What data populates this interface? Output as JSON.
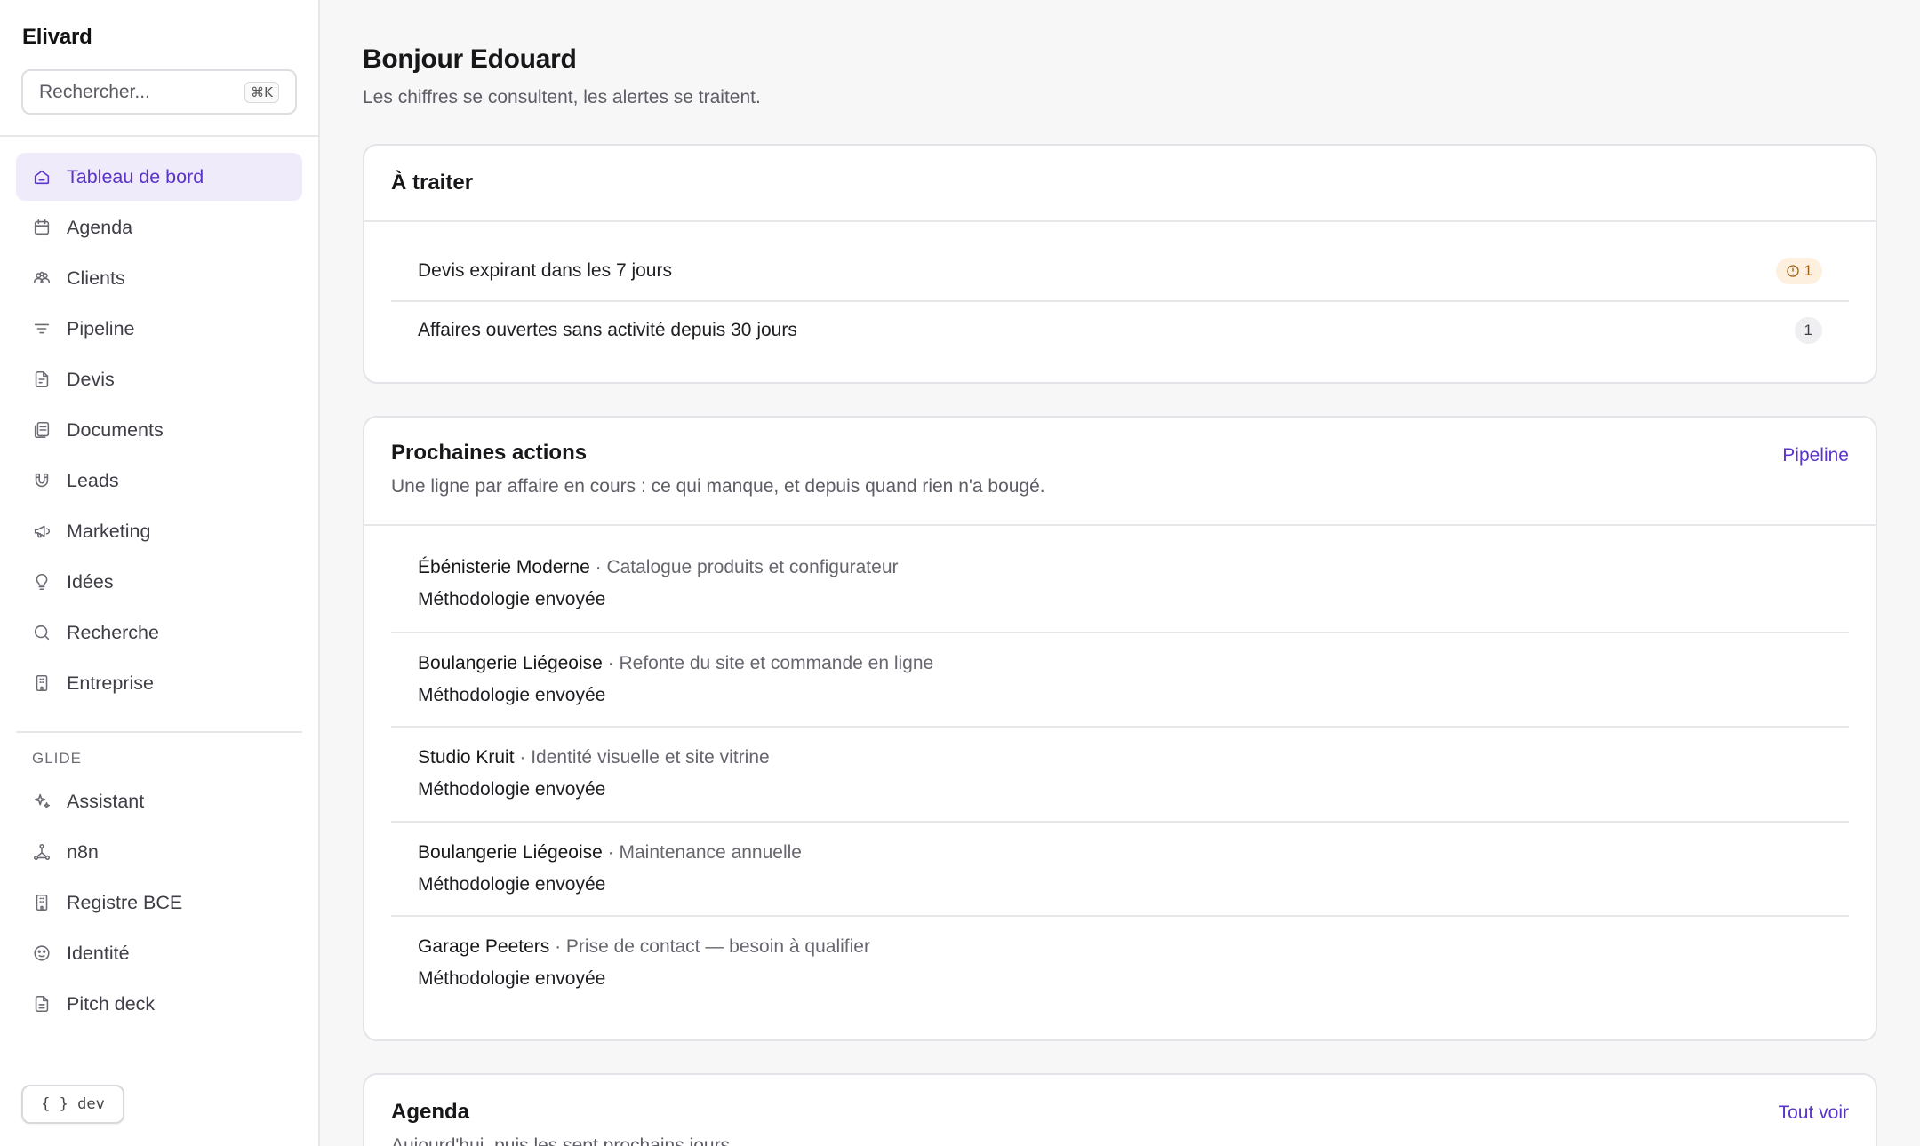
{
  "sidebar": {
    "brand": "Elivard",
    "search": {
      "placeholder": "Rechercher...",
      "shortcut": "⌘K"
    },
    "items": [
      {
        "label": "Tableau de bord",
        "icon": "home-icon",
        "active": true
      },
      {
        "label": "Agenda",
        "icon": "calendar-icon"
      },
      {
        "label": "Clients",
        "icon": "users-icon"
      },
      {
        "label": "Pipeline",
        "icon": "filter-icon"
      },
      {
        "label": "Devis",
        "icon": "file-invoice-icon"
      },
      {
        "label": "Documents",
        "icon": "documents-icon"
      },
      {
        "label": "Leads",
        "icon": "magnet-icon"
      },
      {
        "label": "Marketing",
        "icon": "megaphone-icon"
      },
      {
        "label": "Idées",
        "icon": "lightbulb-icon"
      },
      {
        "label": "Recherche",
        "icon": "search-icon"
      },
      {
        "label": "Entreprise",
        "icon": "building-icon"
      }
    ],
    "section_label": "GLIDE",
    "glide_items": [
      {
        "label": "Assistant",
        "icon": "sparkles-icon"
      },
      {
        "label": "n8n",
        "icon": "workflow-icon"
      },
      {
        "label": "Registre BCE",
        "icon": "building-icon"
      },
      {
        "label": "Identité",
        "icon": "palette-icon"
      },
      {
        "label": "Pitch deck",
        "icon": "presentation-icon"
      }
    ],
    "dev_button": "{ } dev"
  },
  "main": {
    "greeting": "Bonjour Edouard",
    "subtitle": "Les chiffres se consultent, les alertes se traitent.",
    "todo": {
      "title": "À traiter",
      "rows": [
        {
          "label": "Devis expirant dans les 7 jours",
          "count": "1",
          "level": "warning"
        },
        {
          "label": "Affaires ouvertes sans activité depuis 30 jours",
          "count": "1",
          "level": "neutral"
        }
      ]
    },
    "next_actions": {
      "title": "Prochaines actions",
      "description": "Une ligne par affaire en cours : ce qui manque, et depuis quand rien n'a bougé.",
      "link": "Pipeline",
      "rows": [
        {
          "client": "Ébénisterie Moderne",
          "project": " · Catalogue produits et configurateur",
          "status": "Méthodologie envoyée"
        },
        {
          "client": "Boulangerie Liégeoise",
          "project": " · Refonte du site et commande en ligne",
          "status": "Méthodologie envoyée"
        },
        {
          "client": "Studio Kruit",
          "project": " · Identité visuelle et site vitrine",
          "status": "Méthodologie envoyée"
        },
        {
          "client": "Boulangerie Liégeoise",
          "project": " · Maintenance annuelle",
          "status": "Méthodologie envoyée"
        },
        {
          "client": "Garage Peeters",
          "project": " · Prise de contact — besoin à qualifier",
          "status": "Méthodologie envoyée"
        }
      ]
    },
    "agenda": {
      "title": "Agenda",
      "description": "Aujourd'hui, puis les sept prochains jours.",
      "link": "Tout voir"
    }
  },
  "colors": {
    "accent": "#5b34c9",
    "active_bg": "#efebfb",
    "warning_bg": "#fdf0de",
    "warning_fg": "#a0611a"
  }
}
